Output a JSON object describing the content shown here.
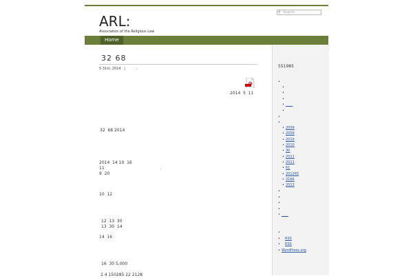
{
  "site": {
    "title": "ARL:",
    "tagline": "Association of the Religious Law"
  },
  "search": {
    "placeholder": "Search"
  },
  "nav": {
    "home": "Home"
  },
  "post": {
    "title": "32  68",
    "meta_date": "5 31st, 2014",
    "meta_sep": "|",
    "meta_extra": "..",
    "pdf_caption": "2014  5  11",
    "paragraphs": [
      "32  68 2014",
      "2014  14 10  16\n11\n9  20",
      "10  12",
      "12  13  30\n13  30  14",
      "14  16",
      "16  30 5,000",
      "2.4 150285 22 2128"
    ],
    "dot": "."
  },
  "sidebar": {
    "counter": "551985",
    "bullets_top": [
      "",
      "",
      "",
      "",
      "",
      ""
    ],
    "archive_links": [
      "2009",
      "2009",
      "2010",
      "2010",
      "30",
      "2011",
      "2011",
      "61",
      "201265",
      "3166",
      "2013"
    ],
    "short_link": "____",
    "bottom_link": "____",
    "rss_entries": "RSS",
    "rss_comments": "RSS",
    "wordpress": "WordPress.org"
  }
}
